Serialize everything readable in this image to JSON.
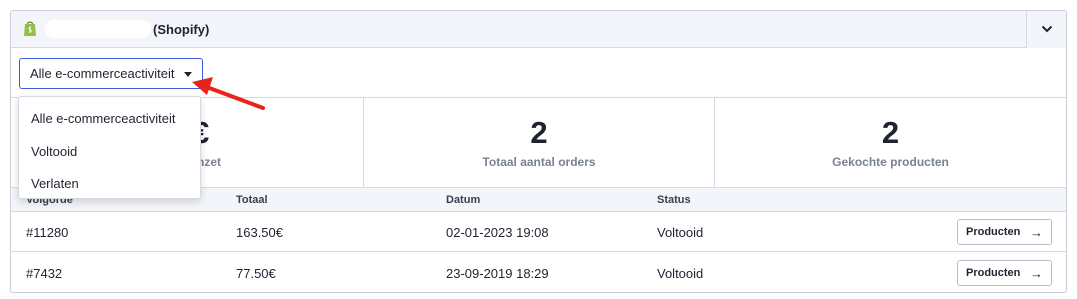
{
  "header": {
    "platform_label": "(Shopify)",
    "collapse_icon": "chevron-down-icon"
  },
  "filter": {
    "selected": "Alle e-commerceactiviteit",
    "options": [
      "Alle e-commerceactiviteit",
      "Voltooid",
      "Verlaten"
    ]
  },
  "stats": [
    {
      "value": "€",
      "label": "nzet"
    },
    {
      "value": "2",
      "label": "Totaal aantal orders"
    },
    {
      "value": "2",
      "label": "Gekochte producten"
    }
  ],
  "table": {
    "columns": [
      "Volgorde",
      "Totaal",
      "Datum",
      "Status"
    ],
    "rows": [
      {
        "order": "#11280",
        "total": "163.50€",
        "date": "02-01-2023 19:08",
        "status": "Voltooid",
        "button": "Producten"
      },
      {
        "order": "#7432",
        "total": "77.50€",
        "date": "23-09-2019 18:29",
        "status": "Voltooid",
        "button": "Producten"
      }
    ]
  },
  "colors": {
    "accent": "#3b5bdb",
    "annotation_arrow": "#e8231c",
    "shopify_green": "#95bf47"
  }
}
